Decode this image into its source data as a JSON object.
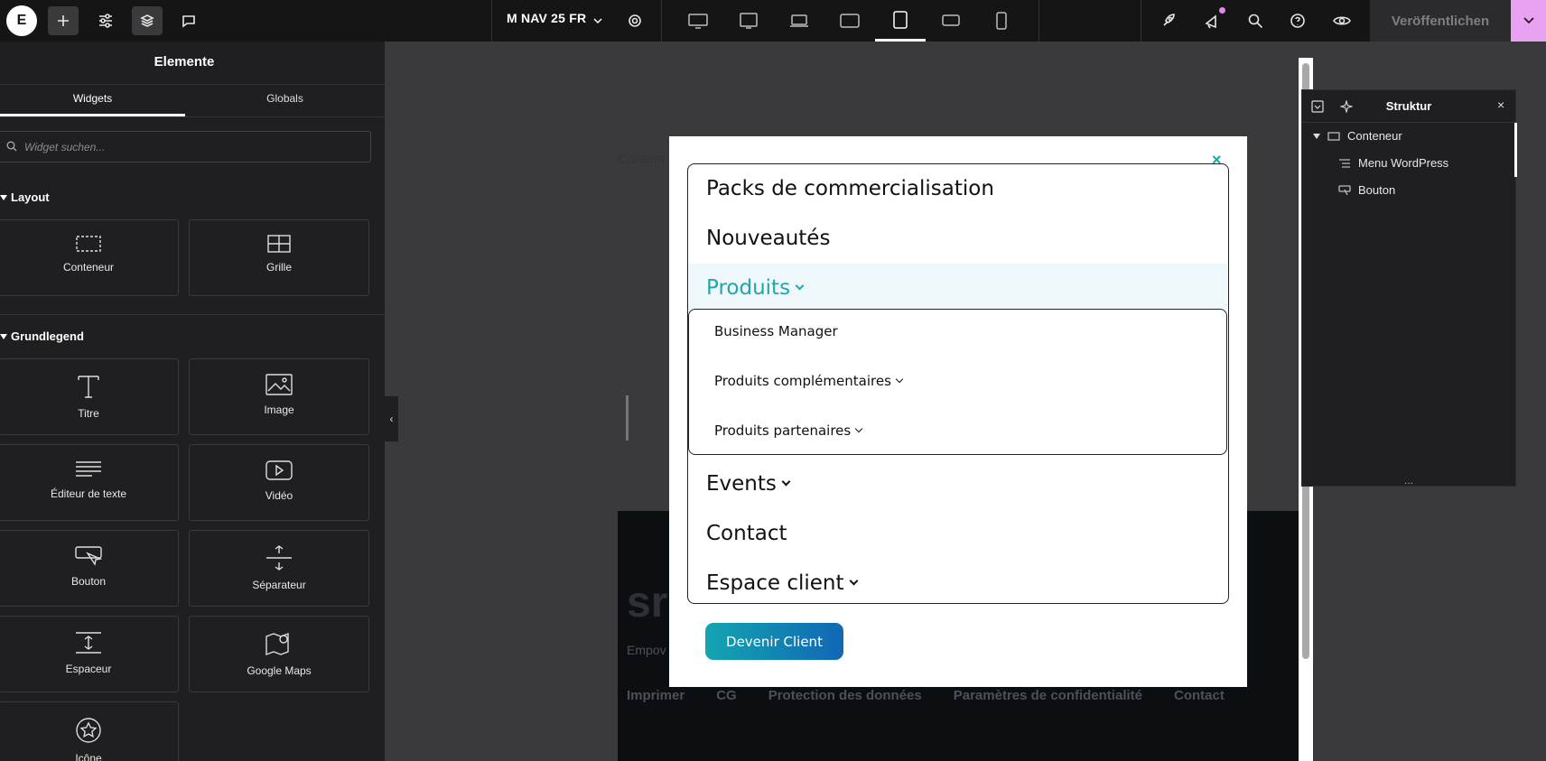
{
  "topbar": {
    "page_name": "M NAV 25 FR",
    "publish_label": "Veröffentlichen",
    "icons": [
      "elementor-logo-icon",
      "add-icon",
      "settings-sliders-icon",
      "layers-icon",
      "comments-icon",
      "chevron-down-icon",
      "gear-icon",
      "desktop-icon",
      "widescreen-icon",
      "laptop-icon",
      "tablet-landscape-icon",
      "tablet-portrait-icon",
      "mobile-landscape-icon",
      "mobile-portrait-icon",
      "rocket-icon",
      "notifications-icon",
      "search-icon",
      "help-icon",
      "preview-eye-icon",
      "caret-down-icon"
    ],
    "active_device": "tablet-portrait",
    "accent_color": "#e9a1f2"
  },
  "panel": {
    "title": "Elemente",
    "tabs": [
      {
        "label": "Widgets",
        "active": true
      },
      {
        "label": "Globals",
        "active": false
      }
    ],
    "search_placeholder": "Widget suchen...",
    "sections": [
      {
        "title": "Layout",
        "widgets": [
          "Conteneur",
          "Grille"
        ]
      },
      {
        "title": "Grundlegend",
        "widgets": [
          "Titre",
          "Image",
          "Éditeur de texte",
          "Vidéo",
          "Bouton",
          "Séparateur",
          "Espaceur",
          "Google Maps",
          "Icône"
        ]
      }
    ]
  },
  "canvas": {
    "content_label": "Content",
    "footer": {
      "brand": "sr",
      "tagline": "Empov",
      "links": [
        "Imprimer",
        "CG",
        "Protection des données",
        "Paramètres de confidentialité",
        "Contact"
      ]
    }
  },
  "menu": {
    "items": [
      {
        "label": "Packs de commercialisation",
        "has_submenu": false
      },
      {
        "label": "Nouveautés",
        "has_submenu": false
      },
      {
        "label": "Produits",
        "has_submenu": true,
        "active": true
      },
      {
        "label": "Events",
        "has_submenu": true
      },
      {
        "label": "Contact",
        "has_submenu": false
      },
      {
        "label": "Espace client",
        "has_submenu": true
      }
    ],
    "submenu": [
      {
        "label": "Business Manager",
        "has_submenu": false
      },
      {
        "label": "Produits complémentaires",
        "has_submenu": true
      },
      {
        "label": "Produits partenaires",
        "has_submenu": true
      }
    ],
    "cta_label": "Devenir Client",
    "active_color": "#26a5a8"
  },
  "structure": {
    "title": "Struktur",
    "tree": [
      {
        "label": "Conteneur",
        "level": 0,
        "expanded": true
      },
      {
        "label": "Menu WordPress",
        "level": 1
      },
      {
        "label": "Bouton",
        "level": 1
      }
    ],
    "footer_label": "..."
  }
}
